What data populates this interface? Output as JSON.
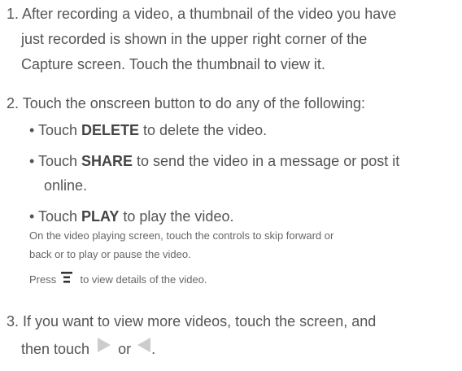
{
  "steps": [
    {
      "lines": [
        "1. After recording a video, a thumbnail of the video you have",
        "just recorded is shown in the upper right corner of the",
        "Capture screen. Touch the thumbnail to view it."
      ]
    },
    {
      "line": "2. Touch the onscreen button to do any of the following:",
      "bullets": [
        {
          "prefix": "• Touch ",
          "bold": "DELETE",
          "suffix": " to delete the video."
        },
        {
          "prefix": "• Touch ",
          "bold": "SHARE",
          "suffix": " to send the video in a message or post it",
          "continuation": "online."
        },
        {
          "prefix": "• Touch ",
          "bold": "PLAY",
          "suffix": " to play the video."
        }
      ],
      "note_lines": [
        "On the video playing screen, touch the controls to skip forward or",
        "back or to play or pause the video."
      ],
      "menu_note": {
        "before": "Press ",
        "after": " to view details of the video.",
        "icon": "menu-icon"
      }
    },
    {
      "line": "3. If you want to view more videos, touch the screen, and",
      "last_line": {
        "before": "then touch ",
        "middle": " or ",
        "after": ".",
        "icons": [
          "play-right-icon",
          "play-left-icon"
        ]
      }
    }
  ],
  "colors": {
    "text": "#555555",
    "icon": "#cccccc",
    "menu_icon": "#333333"
  }
}
